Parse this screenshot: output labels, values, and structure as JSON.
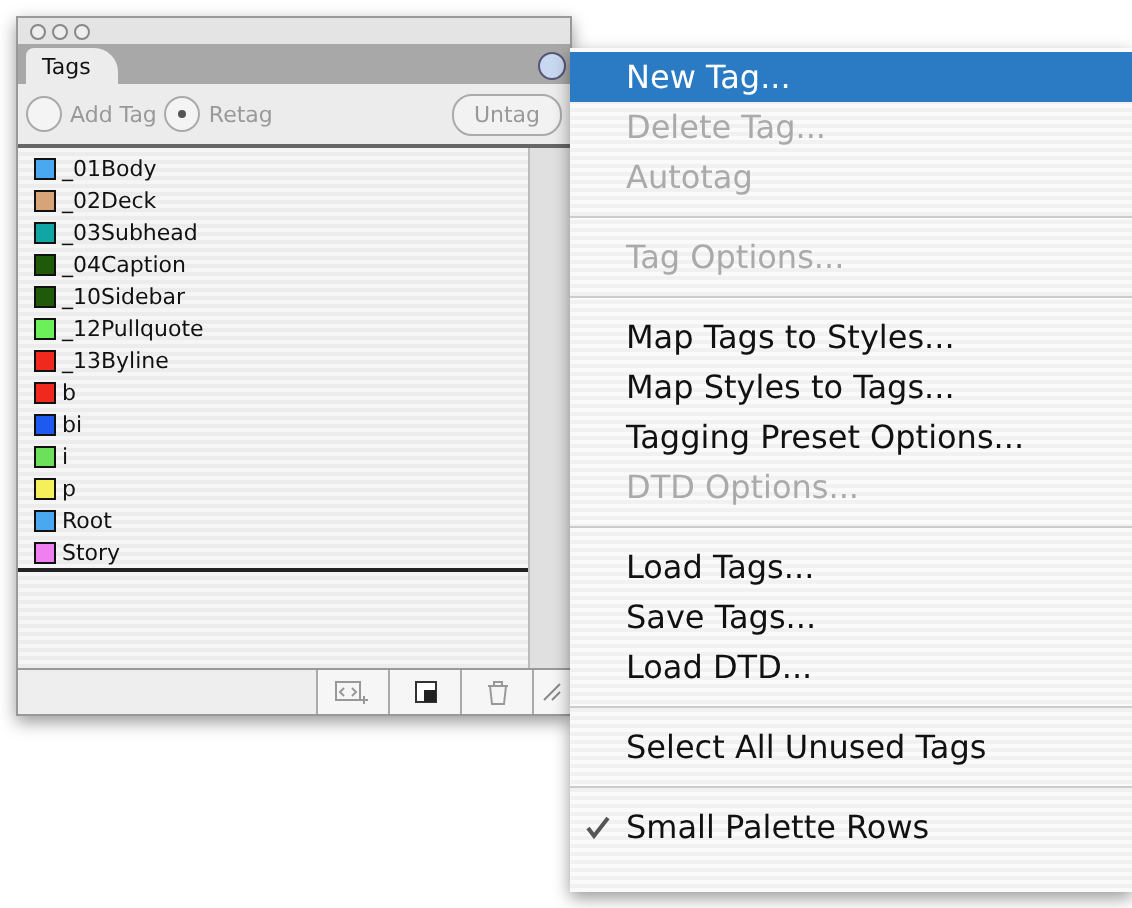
{
  "palette": {
    "tab": "Tags",
    "modes": [
      {
        "label": "Add Tag",
        "selected": false
      },
      {
        "label": "Retag",
        "selected": true
      }
    ],
    "untag_button": {
      "label": "Untag",
      "disabled": true
    },
    "tags": [
      {
        "name": "_01Body",
        "color": "#4aa8f0"
      },
      {
        "name": "_02Deck",
        "color": "#d7a47a"
      },
      {
        "name": "_03Subhead",
        "color": "#12a5a5"
      },
      {
        "name": "_04Caption",
        "color": "#1e5a0a"
      },
      {
        "name": "_10Sidebar",
        "color": "#1e5a0a"
      },
      {
        "name": "_12Pullquote",
        "color": "#6cf05a"
      },
      {
        "name": "_13Byline",
        "color": "#f0281e"
      },
      {
        "name": "b",
        "color": "#f0281e"
      },
      {
        "name": "bi",
        "color": "#1e5af0"
      },
      {
        "name": "i",
        "color": "#6ce05a"
      },
      {
        "name": "p",
        "color": "#f5f05a"
      },
      {
        "name": "Root",
        "color": "#4aa8f0"
      },
      {
        "name": "Story",
        "color": "#f080f0"
      }
    ]
  },
  "menu": [
    {
      "kind": "item",
      "label": "New Tag...",
      "selected": true,
      "disabled": false,
      "checked": false
    },
    {
      "kind": "item",
      "label": "Delete Tag...",
      "selected": false,
      "disabled": true,
      "checked": false
    },
    {
      "kind": "item",
      "label": "Autotag",
      "selected": false,
      "disabled": true,
      "checked": false
    },
    {
      "kind": "separator"
    },
    {
      "kind": "item",
      "label": "Tag Options...",
      "selected": false,
      "disabled": true,
      "checked": false
    },
    {
      "kind": "separator"
    },
    {
      "kind": "item",
      "label": "Map Tags to Styles...",
      "selected": false,
      "disabled": false,
      "checked": false
    },
    {
      "kind": "item",
      "label": "Map Styles to Tags...",
      "selected": false,
      "disabled": false,
      "checked": false
    },
    {
      "kind": "item",
      "label": "Tagging Preset Options...",
      "selected": false,
      "disabled": false,
      "checked": false
    },
    {
      "kind": "item",
      "label": "DTD Options...",
      "selected": false,
      "disabled": true,
      "checked": false
    },
    {
      "kind": "separator"
    },
    {
      "kind": "item",
      "label": "Load Tags...",
      "selected": false,
      "disabled": false,
      "checked": false
    },
    {
      "kind": "item",
      "label": "Save Tags...",
      "selected": false,
      "disabled": false,
      "checked": false
    },
    {
      "kind": "item",
      "label": "Load DTD...",
      "selected": false,
      "disabled": false,
      "checked": false
    },
    {
      "kind": "separator"
    },
    {
      "kind": "item",
      "label": "Select All Unused Tags",
      "selected": false,
      "disabled": false,
      "checked": false
    },
    {
      "kind": "separator"
    },
    {
      "kind": "item",
      "label": "Small Palette Rows",
      "selected": false,
      "disabled": false,
      "checked": true
    }
  ]
}
